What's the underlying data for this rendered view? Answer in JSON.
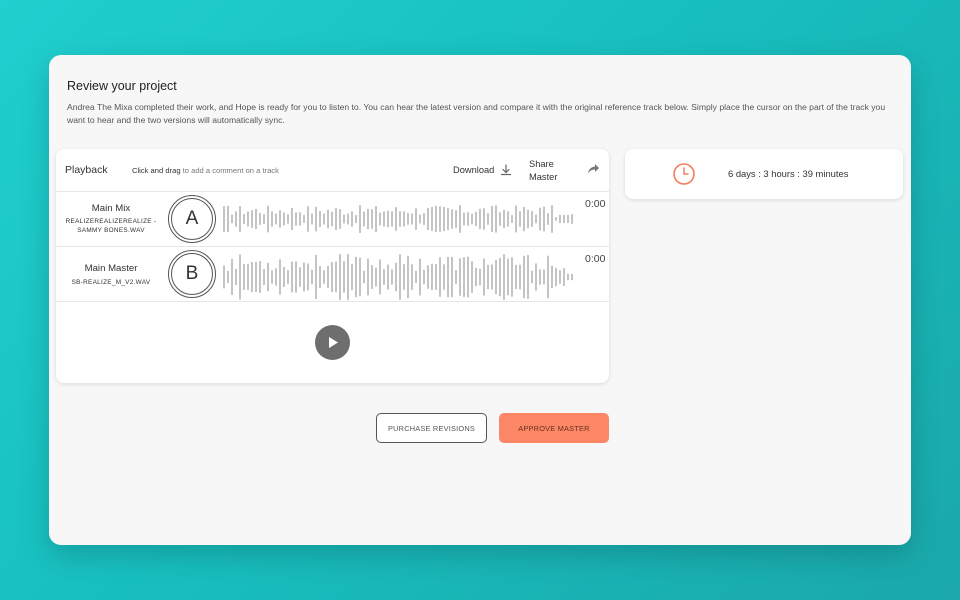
{
  "project": {
    "title": "Review your project",
    "description": "Andrea The Mixa completed their work, and Hope is ready for you to listen to. You can hear the latest version and compare it with the original reference track below. Simply place the cursor on the part of the track you want to hear and the two versions will automatically sync."
  },
  "player": {
    "title": "Playback",
    "hint_bold": "Click and drag",
    "hint_rest": " to add a comment on a track",
    "download_label": "Download",
    "share_label": "Share Master",
    "download_icon": "download-icon",
    "share_icon": "share-arrow-icon",
    "play_icon": "play-icon",
    "tracks": [
      {
        "name": "Main Mix",
        "file": "REALIZEREALIZEREALIZE - SAMMY BONES.WAV",
        "badge": "A",
        "time": "0:00"
      },
      {
        "name": "Main Master",
        "file": "SB-REALIZE_M_V2.WAV",
        "badge": "B",
        "time": "0:00"
      }
    ]
  },
  "timer": {
    "icon": "clock-icon",
    "text": "6 days : 3 hours : 39 minutes",
    "accent": "#f27c5c"
  },
  "actions": {
    "purchase_label": "PURCHASE REVISIONS",
    "approve_label": "APPROVE MASTER",
    "approve_color": "#fc8766"
  }
}
